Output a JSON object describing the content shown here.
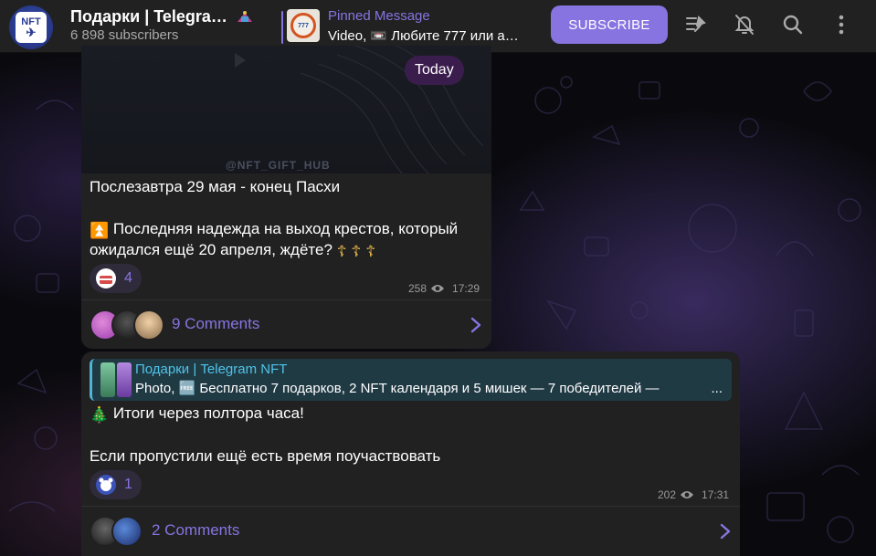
{
  "header": {
    "title": "Подарки | Telegra…",
    "subscribers": "6 898 subscribers",
    "pinned_label": "Pinned Message",
    "pinned_text": "Video, 📼 Любите 777 или а…",
    "subscribe_label": "SUBSCRIBE"
  },
  "messages": [
    {
      "date_badge": "Today",
      "watermark": "@NFT_GIFT_HUB",
      "line1": "Послезавтра 29 мая - конец Пасхи",
      "line2": "Последняя надежда на выход крестов, который",
      "line3": "ожидался ещё 20 апреля, ждёте?",
      "reaction_count": "4",
      "views": "258",
      "time": "17:29",
      "comments": "9 Comments"
    },
    {
      "forward_title": "Подарки | Telegram NFT",
      "forward_text": "Photo, 🆓 Бесплатно 7 подарков, 2 NFT календаря и 5 мишек — 7 победителей —",
      "forward_more": "...",
      "line1": "Итоги через полтора часа!",
      "line2": "Если пропустили ещё есть время поучаствовать",
      "reaction_count": "1",
      "views": "202",
      "time": "17:31",
      "comments": "2 Comments"
    }
  ],
  "colors": {
    "accent": "#8774e1",
    "bubble": "#212121",
    "header": "#212121",
    "forward_bg": "#203a44",
    "forward_title": "#4fc3e8"
  }
}
